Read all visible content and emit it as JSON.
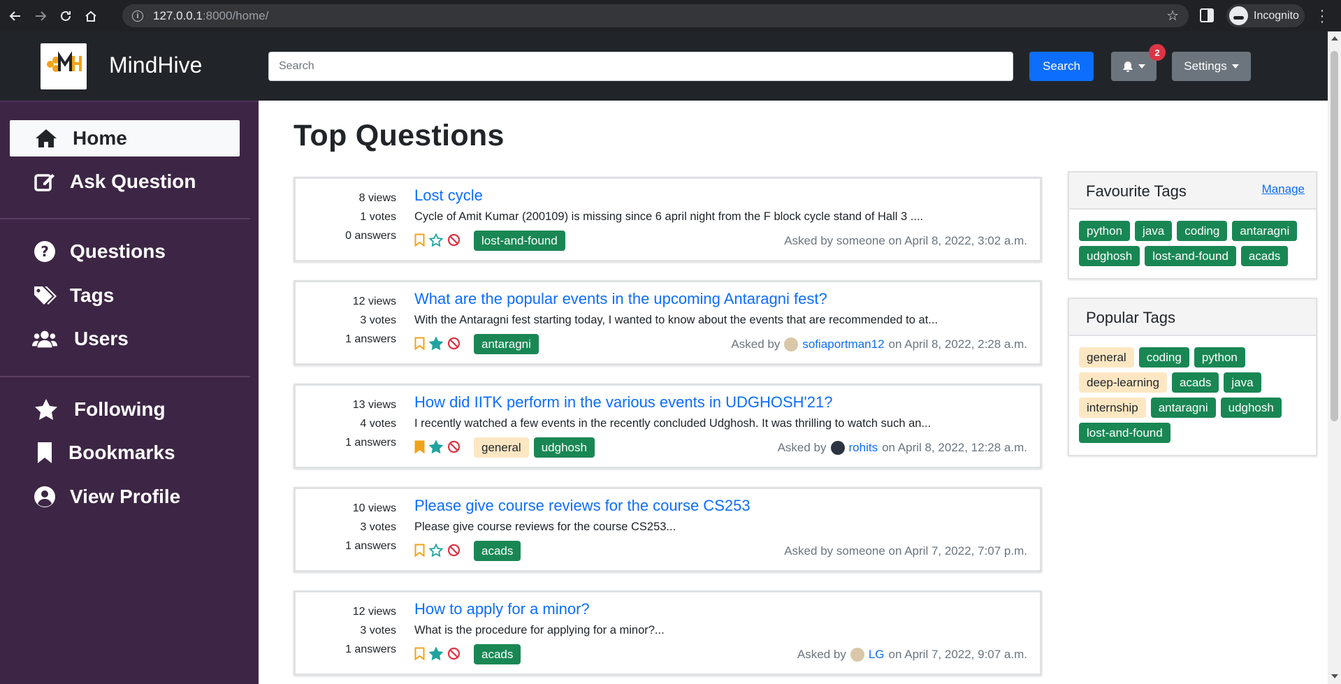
{
  "browser": {
    "url_host": "127.0.0.1",
    "url_path": ":8000/home/",
    "profile_label": "Incognito"
  },
  "header": {
    "brand": "MindHive",
    "search_placeholder": "Search",
    "search_button": "Search",
    "notification_count": "2",
    "settings_label": "Settings"
  },
  "sidebar": {
    "items": [
      {
        "label": "Home",
        "icon": "home-icon",
        "active": true
      },
      {
        "label": "Ask Question",
        "icon": "edit-icon"
      },
      {
        "label": "Questions",
        "icon": "question-circle-icon"
      },
      {
        "label": "Tags",
        "icon": "tags-icon"
      },
      {
        "label": "Users",
        "icon": "users-icon"
      },
      {
        "label": "Following",
        "icon": "star-icon"
      },
      {
        "label": "Bookmarks",
        "icon": "bookmark-icon"
      },
      {
        "label": "View Profile",
        "icon": "user-circle-icon"
      }
    ]
  },
  "main": {
    "title": "Top Questions",
    "questions": [
      {
        "views": "8 views",
        "votes": "1 votes",
        "answers": "0 answers",
        "title": "Lost cycle",
        "excerpt": "Cycle of Amit Kumar (200109) is missing since 6 april night from the F block cycle stand of Hall 3 ....",
        "bookmarked": false,
        "followed": false,
        "tags": [
          {
            "name": "lost-and-found",
            "style": "green"
          }
        ],
        "meta_prefix": "Asked by someone on April 8, 2022, 3:02 a.m.",
        "user": "",
        "meta_suffix": ""
      },
      {
        "views": "12 views",
        "votes": "3 votes",
        "answers": "1 answers",
        "title": "What are the popular events in the upcoming Antaragni fest?",
        "excerpt": "With the Antaragni fest starting today, I wanted to know about the events that are recommended to at...",
        "bookmarked": false,
        "followed": true,
        "tags": [
          {
            "name": "antaragni",
            "style": "green"
          }
        ],
        "meta_prefix": "Asked by",
        "user": "sofiaportman12",
        "meta_suffix": "on April 8, 2022, 2:28 a.m."
      },
      {
        "views": "13 views",
        "votes": "4 votes",
        "answers": "1 answers",
        "title": "How did IITK perform in the various events in UDGHOSH'21?",
        "excerpt": "I recently watched a few events in the recently concluded Udghosh. It was thrilling to watch such an...",
        "bookmarked": true,
        "followed": true,
        "tags": [
          {
            "name": "general",
            "style": "cream"
          },
          {
            "name": "udghosh",
            "style": "green"
          }
        ],
        "meta_prefix": "Asked by",
        "user": "rohits",
        "meta_suffix": "on April 8, 2022, 12:28 a.m."
      },
      {
        "views": "10 views",
        "votes": "3 votes",
        "answers": "1 answers",
        "title": "Please give course reviews for the course CS253",
        "excerpt": "Please give course reviews for the course CS253...",
        "bookmarked": false,
        "followed": false,
        "tags": [
          {
            "name": "acads",
            "style": "green"
          }
        ],
        "meta_prefix": "Asked by someone on April 7, 2022, 7:07 p.m.",
        "user": "",
        "meta_suffix": ""
      },
      {
        "views": "12 views",
        "votes": "3 votes",
        "answers": "1 answers",
        "title": "How to apply for a minor?",
        "excerpt": "What is the procedure for applying for a minor?...",
        "bookmarked": false,
        "followed": true,
        "tags": [
          {
            "name": "acads",
            "style": "green"
          }
        ],
        "meta_prefix": "Asked by",
        "user": "LG",
        "meta_suffix": "on April 7, 2022, 9:07 a.m."
      }
    ]
  },
  "favourite_tags": {
    "title": "Favourite Tags",
    "manage_label": "Manage",
    "tags": [
      "python",
      "java",
      "coding",
      "antaragni",
      "udghosh",
      "lost-and-found",
      "acads"
    ]
  },
  "popular_tags": {
    "title": "Popular Tags",
    "tags": [
      {
        "name": "general",
        "style": "cream"
      },
      {
        "name": "coding",
        "style": "green"
      },
      {
        "name": "python",
        "style": "green"
      },
      {
        "name": "deep-learning",
        "style": "cream"
      },
      {
        "name": "acads",
        "style": "green"
      },
      {
        "name": "java",
        "style": "green"
      },
      {
        "name": "internship",
        "style": "cream"
      },
      {
        "name": "antaragni",
        "style": "green"
      },
      {
        "name": "udghosh",
        "style": "green"
      },
      {
        "name": "lost-and-found",
        "style": "green"
      }
    ]
  },
  "colors": {
    "sidebar_bg": "#3d2645",
    "header_bg": "#212529",
    "primary": "#0d6efd",
    "tag_green": "#198754",
    "tag_cream": "#fde7c3",
    "bookmark": "#f0a31a",
    "follow_star": "#20a39e",
    "block": "#dc3545"
  }
}
